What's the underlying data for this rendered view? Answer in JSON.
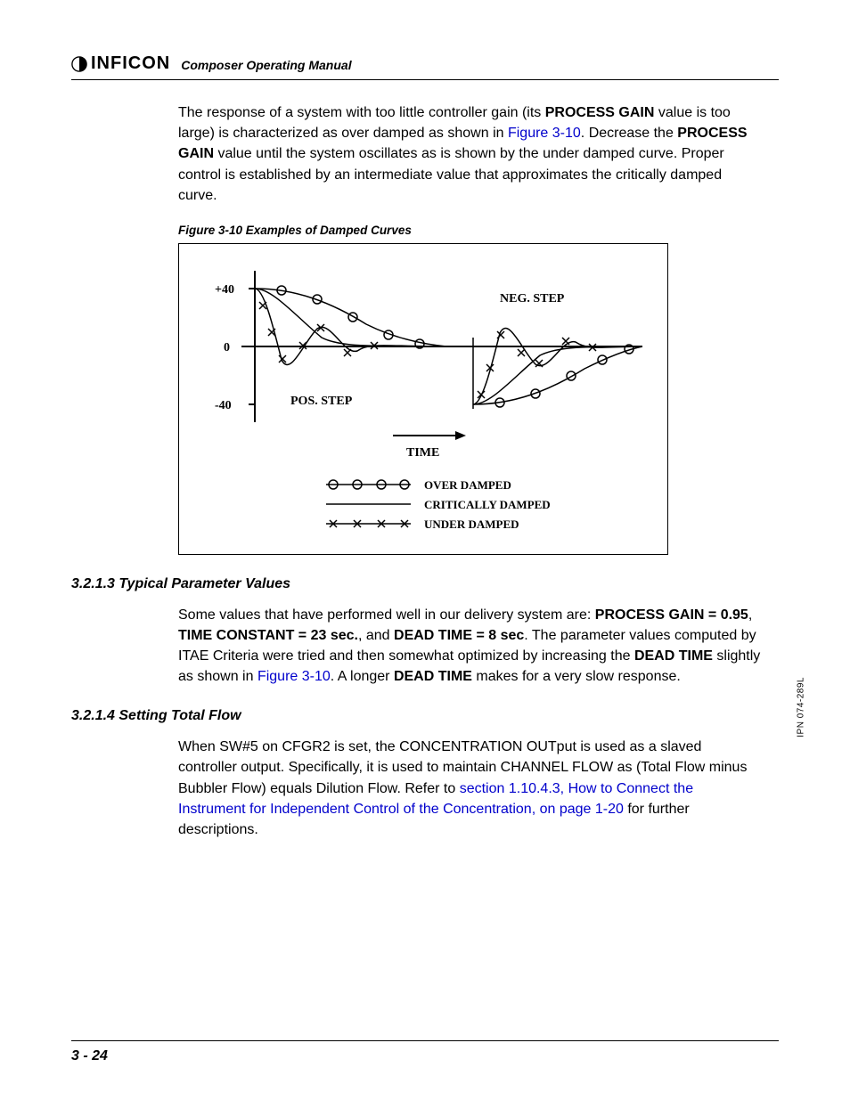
{
  "header": {
    "brand": "INFICON",
    "title": "Composer Operating Manual"
  },
  "para1": {
    "t1": "The response of a system with too little controller gain (its ",
    "b1": "PROCESS GAIN",
    "t2": " value is too large) is characterized as over damped as shown in ",
    "l1": "Figure 3-10",
    "t3": ". Decrease the ",
    "b2": "PROCESS GAIN",
    "t4": " value until the system oscillates as is shown by the under damped curve. Proper control is established by an intermediate value that approximates the critically damped curve."
  },
  "figure": {
    "caption": "Figure 3-10  Examples of Damped Curves",
    "y_plus40": "+40",
    "y_zero": "0",
    "y_minus40": "-40",
    "neg_step": "NEG. STEP",
    "pos_step": "POS. STEP",
    "time": "TIME",
    "legend_over": "OVER DAMPED",
    "legend_crit": "CRITICALLY DAMPED",
    "legend_under": "UNDER DAMPED"
  },
  "section3213": {
    "heading": "3.2.1.3  Typical Parameter Values",
    "t1": "Some values that have performed well in our delivery system are: ",
    "b1": "PROCESS GAIN = 0.95",
    "t2": ", ",
    "b2": "TIME CONSTANT = 23 sec.",
    "t3": ", and ",
    "b3": "DEAD TIME = 8 sec",
    "t4": ". The parameter values computed by ITAE Criteria were tried and then somewhat optimized by increasing the ",
    "b4": "DEAD TIME",
    "t5": " slightly as shown in ",
    "l1": "Figure 3-10",
    "t6": ". A longer ",
    "b5": "DEAD TIME",
    "t7": " makes for a very slow response."
  },
  "section3214": {
    "heading": "3.2.1.4  Setting Total Flow",
    "t1": "When SW#5 on CFGR2 is set, the CONCENTRATION OUTput is used as a slaved controller output. Specifically, it is used to maintain CHANNEL FLOW as (Total Flow minus Bubbler Flow) equals Dilution Flow. Refer to ",
    "l1": "section 1.10.4.3, How to Connect the Instrument for Independent Control of the Concentration, on page 1-20",
    "t2": " for further descriptions."
  },
  "footer": {
    "page": "3 - 24",
    "side": "IPN 074-289L"
  },
  "chart_data": {
    "type": "line",
    "title": "Examples of Damped Curves",
    "xlabel": "TIME",
    "ylabel": "",
    "ylim": [
      -40,
      40
    ],
    "y_ticks": [
      -40,
      0,
      40
    ],
    "series": [
      {
        "name": "OVER DAMPED",
        "marker": "o",
        "description": "positive-step over-damped response: slow monotonic approach to 0 from +40; negative-step mirrored from -40"
      },
      {
        "name": "CRITICALLY DAMPED",
        "marker": "none",
        "description": "critically damped: quicker approach to 0 without overshoot on both positive and negative steps"
      },
      {
        "name": "UNDER DAMPED",
        "marker": "x",
        "description": "under-damped: oscillates across 0 with decaying amplitude before settling"
      }
    ],
    "annotations": [
      "POS. STEP",
      "NEG. STEP"
    ]
  }
}
